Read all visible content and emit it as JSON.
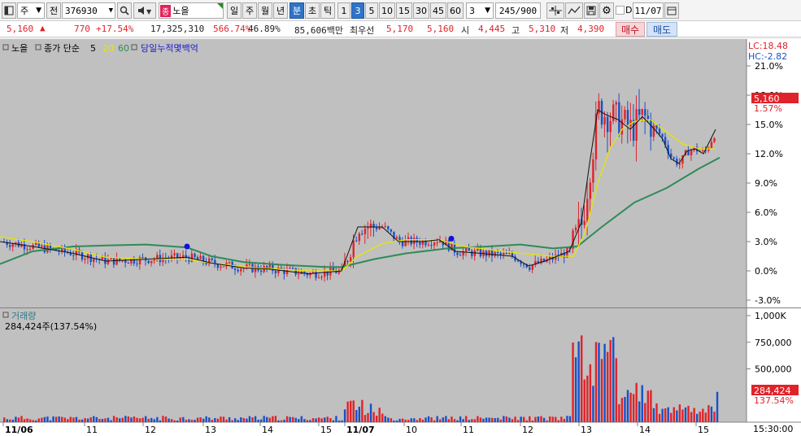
{
  "toolbar": {
    "market": "주",
    "prev_label": "전",
    "code": "376930",
    "stock_tag": "종",
    "stock_name": "노을",
    "periods": [
      "일",
      "주",
      "월",
      "년",
      "분",
      "초",
      "틱"
    ],
    "active_period": "분",
    "intervals": [
      "1",
      "3",
      "5",
      "10",
      "15",
      "30",
      "45",
      "60"
    ],
    "active_interval": "3",
    "interval_select": "3",
    "count": "245/900",
    "date_check": "D",
    "date": "11/07"
  },
  "quote": {
    "price": "5,160",
    "change": "770",
    "change_pct": "+17.54%",
    "volume": "17,325,310",
    "volume_ratio": "566.74%",
    "turnover": "46.89%",
    "amount": "85,606백만",
    "best_ask_label": "최우선",
    "best_ask": "5,170",
    "best_bid": "5,160",
    "open_label": "시",
    "open": "4,445",
    "high_label": "고",
    "high": "5,310",
    "low_label": "저",
    "low": "4,390",
    "buy_label": "매수",
    "sell_label": "매도"
  },
  "chart_data": {
    "type": "candlestick",
    "price_panel": {
      "legend": [
        "노을",
        "종가 단순",
        "5",
        "20",
        "60",
        "당일누적몇백억"
      ],
      "lc": "LC:18.48",
      "hc": "HC:-2.82",
      "y_ticks": [
        "21.0%",
        "18.0%",
        "15.0%",
        "12.0%",
        "9.0%",
        "6.0%",
        "3.0%",
        "0.0%",
        "-3.0%"
      ],
      "current_price_box": "5,160",
      "current_pct": "1.57%",
      "ylim": [
        -3.0,
        21.0
      ]
    },
    "volume_panel": {
      "title": "거래량",
      "info": "284,424주(137.54%)",
      "y_ticks": [
        "1,000K",
        "750,000",
        "500,000"
      ],
      "current_volume_box": "284,424",
      "current_pct": "137.54%",
      "ylim": [
        0,
        1000000
      ]
    },
    "x_ticks": [
      "11/06",
      "11",
      "12",
      "13",
      "14",
      "15",
      "11/07",
      "10",
      "11",
      "12",
      "13",
      "14",
      "15"
    ],
    "time_label": "15:30:00",
    "ma5": [
      [
        0,
        3.0
      ],
      [
        40,
        2.5
      ],
      [
        90,
        1.8
      ],
      [
        130,
        1.0
      ],
      [
        180,
        1.2
      ],
      [
        230,
        1.4
      ],
      [
        260,
        0.8
      ],
      [
        300,
        0.3
      ],
      [
        330,
        0.2
      ],
      [
        380,
        -0.3
      ],
      [
        420,
        0.0
      ],
      [
        440,
        4.5
      ],
      [
        470,
        4.5
      ],
      [
        490,
        3.0
      ],
      [
        520,
        3.0
      ],
      [
        540,
        3.2
      ],
      [
        560,
        2.0
      ],
      [
        590,
        1.8
      ],
      [
        630,
        1.5
      ],
      [
        650,
        0.5
      ],
      [
        670,
        1.0
      ],
      [
        700,
        2.0
      ],
      [
        715,
        5.0
      ],
      [
        725,
        11.0
      ],
      [
        735,
        16.5
      ],
      [
        745,
        16.0
      ],
      [
        760,
        15.5
      ],
      [
        775,
        14.5
      ],
      [
        790,
        15.8
      ],
      [
        805,
        14.5
      ],
      [
        815,
        13.5
      ],
      [
        825,
        11.5
      ],
      [
        835,
        11.0
      ],
      [
        845,
        12.3
      ],
      [
        855,
        12.5
      ],
      [
        865,
        12.0
      ],
      [
        880,
        14.5
      ]
    ],
    "ma20": [
      [
        0,
        3.5
      ],
      [
        40,
        3.0
      ],
      [
        90,
        2.2
      ],
      [
        130,
        1.4
      ],
      [
        180,
        1.2
      ],
      [
        230,
        1.2
      ],
      [
        260,
        0.8
      ],
      [
        300,
        0.4
      ],
      [
        340,
        0.2
      ],
      [
        380,
        0.0
      ],
      [
        420,
        0.0
      ],
      [
        440,
        1.5
      ],
      [
        470,
        2.8
      ],
      [
        500,
        3.2
      ],
      [
        540,
        3.2
      ],
      [
        570,
        2.5
      ],
      [
        600,
        2.2
      ],
      [
        640,
        1.8
      ],
      [
        680,
        1.5
      ],
      [
        705,
        1.5
      ],
      [
        720,
        4.0
      ],
      [
        735,
        9.0
      ],
      [
        750,
        12.5
      ],
      [
        765,
        14.5
      ],
      [
        780,
        15.3
      ],
      [
        800,
        15.5
      ],
      [
        820,
        14.2
      ],
      [
        840,
        13.0
      ],
      [
        860,
        12.5
      ],
      [
        880,
        12.5
      ]
    ],
    "ma60": [
      [
        0,
        0.7
      ],
      [
        40,
        2.0
      ],
      [
        90,
        2.5
      ],
      [
        130,
        2.6
      ],
      [
        180,
        2.7
      ],
      [
        230,
        2.4
      ],
      [
        260,
        1.5
      ],
      [
        300,
        0.9
      ],
      [
        350,
        0.6
      ],
      [
        400,
        0.4
      ],
      [
        420,
        0.4
      ],
      [
        460,
        1.2
      ],
      [
        500,
        1.8
      ],
      [
        550,
        2.3
      ],
      [
        600,
        2.5
      ],
      [
        640,
        2.7
      ],
      [
        680,
        2.3
      ],
      [
        710,
        2.5
      ],
      [
        740,
        4.5
      ],
      [
        780,
        7.0
      ],
      [
        820,
        8.5
      ],
      [
        860,
        10.5
      ],
      [
        885,
        11.6
      ]
    ],
    "markers": [
      [
        230,
        2.5
      ],
      [
        555,
        3.3
      ]
    ]
  }
}
